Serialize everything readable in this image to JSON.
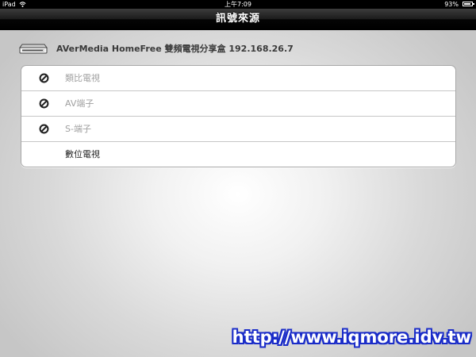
{
  "status_bar": {
    "carrier": "iPad",
    "time": "上午7:09",
    "battery_percent": "93%",
    "battery_level": 0.93
  },
  "nav": {
    "title": "訊號來源"
  },
  "device": {
    "label": "AVerMedia HomeFree 雙頻電視分享盒 192.168.26.7",
    "icon": "set-top-box-icon"
  },
  "sources": [
    {
      "label": "類比電視",
      "enabled": false,
      "icon": "prohibited-icon"
    },
    {
      "label": "AV端子",
      "enabled": false,
      "icon": "prohibited-icon"
    },
    {
      "label": "S-端子",
      "enabled": false,
      "icon": "prohibited-icon"
    },
    {
      "label": "數位電視",
      "enabled": true
    }
  ],
  "watermark": "http://www.iqmore.idv.tw",
  "colors": {
    "watermark_outline": "#1a2cc8",
    "disabled_text": "#a0a0a0",
    "enabled_text": "#222222"
  }
}
